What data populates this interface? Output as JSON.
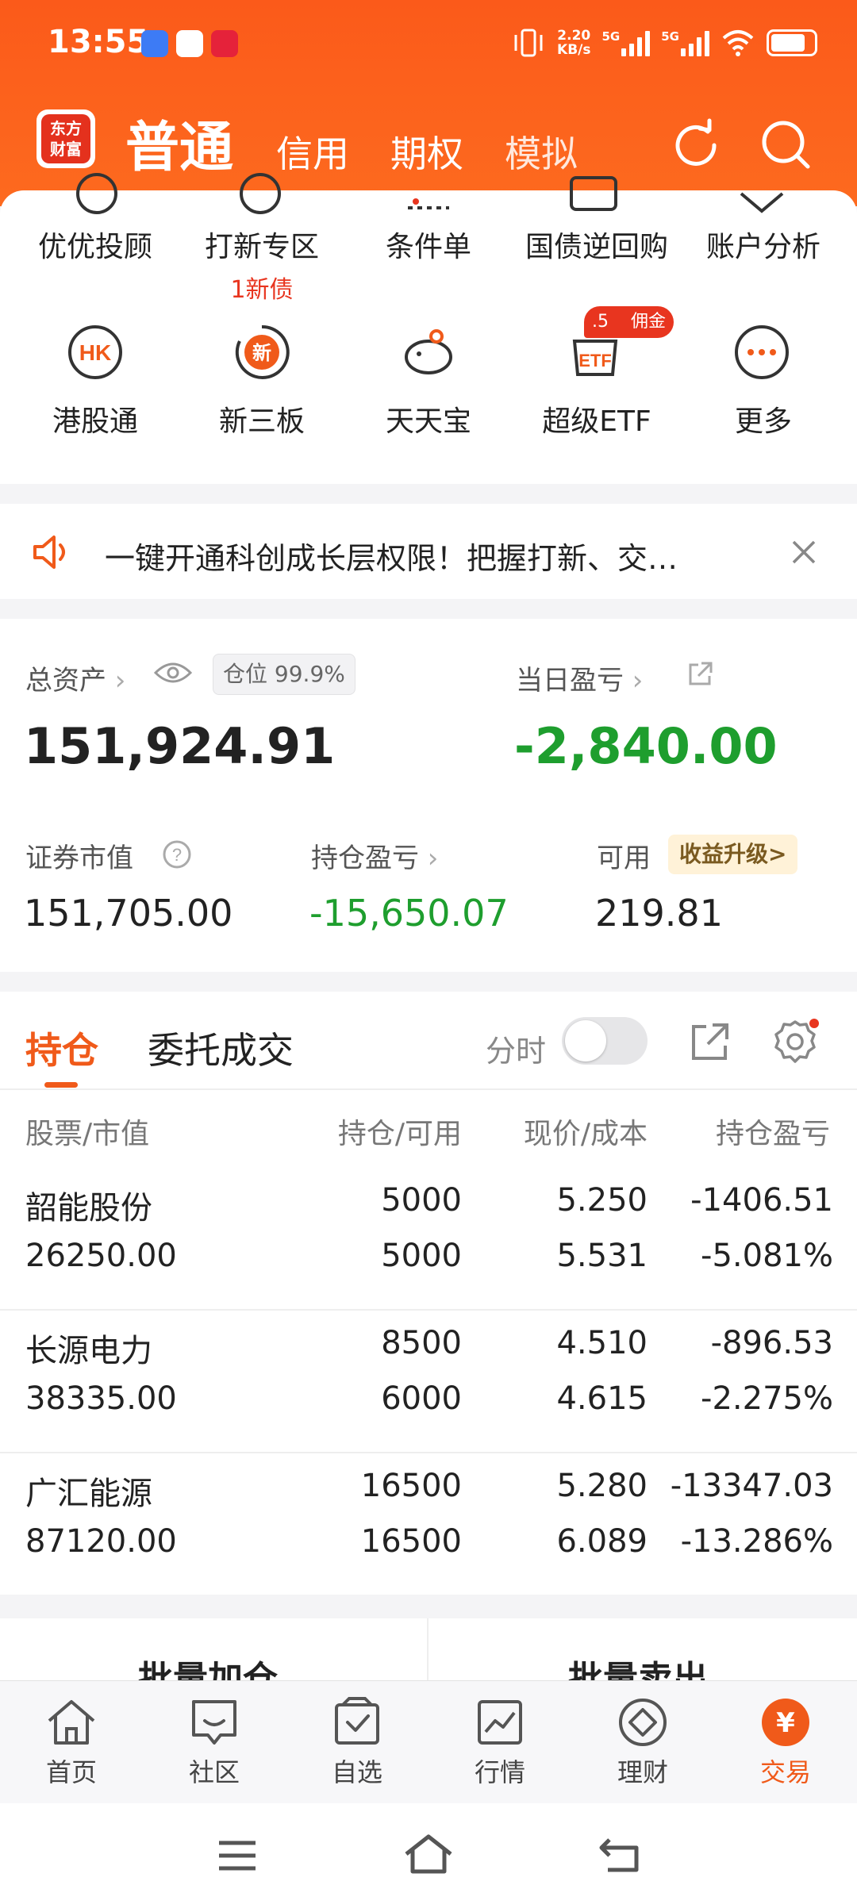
{
  "status": {
    "time": "13:55",
    "speed_top": "2.20",
    "speed_unit": "KB/s",
    "net1": "5G",
    "net2": "5G"
  },
  "header": {
    "logo_line1": "东方",
    "logo_line2": "财富",
    "tabs": [
      "普通",
      "信用",
      "期权",
      "模拟"
    ],
    "refresh_icon": "refresh-icon",
    "search_icon": "search-icon"
  },
  "grid": {
    "row1": [
      {
        "label": "优优投顾"
      },
      {
        "label": "打新专区",
        "sub": "1新债"
      },
      {
        "label": "条件单"
      },
      {
        "label": "国债逆回购"
      },
      {
        "label": "账户分析"
      }
    ],
    "row2": [
      {
        "label": "港股通",
        "icon_text": "HK"
      },
      {
        "label": "新三板",
        "icon_text": "新"
      },
      {
        "label": "天天宝"
      },
      {
        "label": "超级ETF",
        "icon_text": "ETF",
        "badge_left": ".5",
        "badge_right": "佣金"
      },
      {
        "label": "更多"
      }
    ]
  },
  "notice": {
    "text": "一键开通科创成长层权限！把握打新、交…"
  },
  "assets": {
    "total_label": "总资产",
    "position_ratio_label": "仓位",
    "position_ratio": "99.9%",
    "total_value": "151,924.91",
    "daily_pl_label": "当日盈亏",
    "daily_pl": "-2,840.00",
    "market_value_label": "证券市值",
    "market_value": "151,705.00",
    "holding_pl_label": "持仓盈亏",
    "holding_pl": "-15,650.07",
    "available_label": "可用",
    "available": "219.81",
    "upgrade_label": "收益升级>"
  },
  "positions": {
    "tab_active": "持仓",
    "tab_other": "委托成交",
    "fenshi_label": "分时",
    "headers": [
      "股票/市值",
      "持仓/可用",
      "现价/成本",
      "持仓盈亏"
    ],
    "rows": [
      {
        "name": "韶能股份",
        "mv": "26250.00",
        "hold": "5000",
        "avail": "5000",
        "price": "5.250",
        "cost": "5.531",
        "pl": "-1406.51",
        "pl_pct": "-5.081%"
      },
      {
        "name": "长源电力",
        "mv": "38335.00",
        "hold": "8500",
        "avail": "6000",
        "price": "4.510",
        "cost": "4.615",
        "pl": "-896.53",
        "pl_pct": "-2.275%"
      },
      {
        "name": "广汇能源",
        "mv": "87120.00",
        "hold": "16500",
        "avail": "16500",
        "price": "5.280",
        "cost": "6.089",
        "pl": "-13347.03",
        "pl_pct": "-13.286%"
      }
    ]
  },
  "batch": {
    "add": "批量加仓",
    "sell": "批量卖出"
  },
  "nav": {
    "items": [
      "首页",
      "社区",
      "自选",
      "行情",
      "理财",
      "交易"
    ],
    "trade_glyph": "¥"
  },
  "colors": {
    "brand_orange": "#fb5a1a",
    "loss_green": "#1e9e2e",
    "accent_red": "#e8351f"
  }
}
